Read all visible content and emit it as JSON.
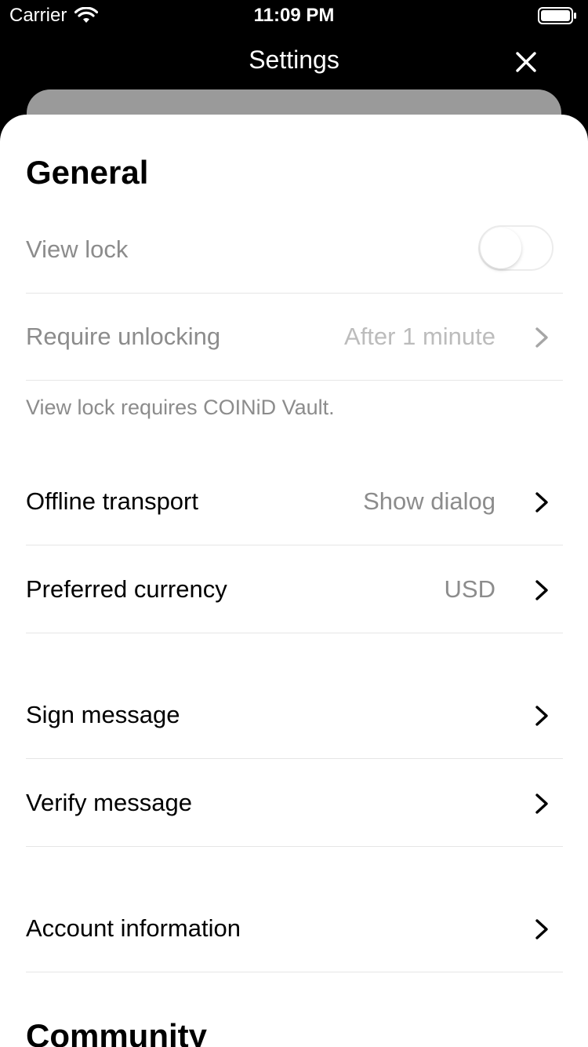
{
  "status_bar": {
    "carrier": "Carrier",
    "time": "11:09 PM"
  },
  "header": {
    "title": "Settings"
  },
  "general": {
    "title": "General",
    "view_lock": {
      "label": "View lock",
      "enabled": false
    },
    "require_unlocking": {
      "label": "Require unlocking",
      "value": "After 1 minute"
    },
    "note": "View lock requires COINiD Vault.",
    "offline_transport": {
      "label": "Offline transport",
      "value": "Show dialog"
    },
    "preferred_currency": {
      "label": "Preferred currency",
      "value": "USD"
    },
    "sign_message": {
      "label": "Sign message"
    },
    "verify_message": {
      "label": "Verify message"
    },
    "account_information": {
      "label": "Account information"
    }
  },
  "community": {
    "title": "Community"
  },
  "colors": {
    "background": "#000000",
    "sheet": "#ffffff",
    "secondary_text": "#8c8c8c",
    "disabled_text": "#bcbcbc",
    "divider": "#e6e6e6"
  }
}
